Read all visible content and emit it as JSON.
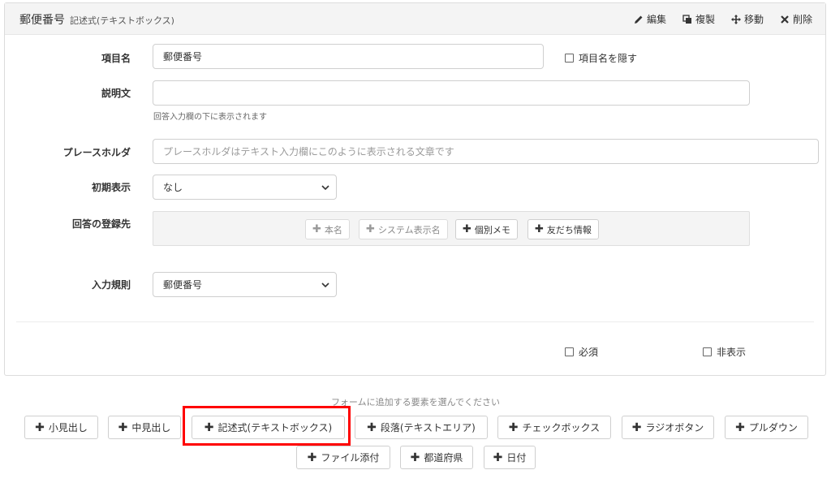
{
  "header": {
    "title": "郵便番号",
    "subtitle": "記述式(テキストボックス)",
    "actions": {
      "edit": "編集",
      "copy": "複製",
      "move": "移動",
      "delete": "削除"
    }
  },
  "form": {
    "item_name": {
      "label": "項目名",
      "value": "郵便番号",
      "hide_label": "項目名を隠す"
    },
    "description": {
      "label": "説明文",
      "value": "",
      "help": "回答入力欄の下に表示されます"
    },
    "placeholder": {
      "label": "プレースホルダ",
      "placeholder": "プレースホルダはテキスト入力欄にこのように表示される文章です"
    },
    "initial": {
      "label": "初期表示",
      "value": "なし"
    },
    "destination": {
      "label": "回答の登録先",
      "chips": {
        "name": "本名",
        "system": "システム表示名",
        "memo": "個別メモ",
        "friend": "友だち情報"
      }
    },
    "rule": {
      "label": "入力規則",
      "value": "郵便番号"
    },
    "footer": {
      "required": "必須",
      "hidden": "非表示"
    }
  },
  "add_panel": {
    "title": "フォームに追加する要素を選んでください",
    "buttons": {
      "small_heading": "小見出し",
      "medium_heading": "中見出し",
      "textbox": "記述式(テキストボックス)",
      "paragraph": "段落(テキストエリア)",
      "checkbox": "チェックボックス",
      "radio": "ラジオボタン",
      "pulldown": "プルダウン",
      "file": "ファイル添付",
      "prefecture": "都道府県",
      "date": "日付"
    }
  },
  "colors": {
    "highlight": "#ff0000",
    "header_bg": "#f4f4f4"
  }
}
